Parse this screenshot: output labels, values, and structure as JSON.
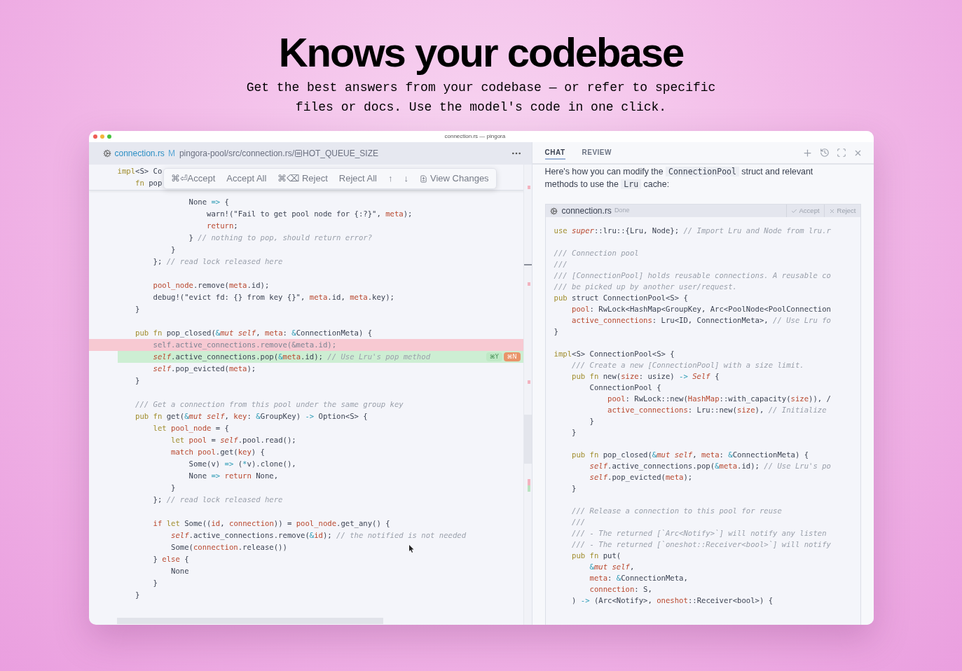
{
  "hero": {
    "title": "Knows your codebase",
    "subtitle": "Get the best answers from your codebase — or refer to specific files or docs. Use the model's code in one click."
  },
  "window": {
    "title": "connection.rs — pingora"
  },
  "editor": {
    "breadcrumb": {
      "file": "connection.rs",
      "status": "M",
      "path": "pingora-pool/src/connection.rs/",
      "symbol": "HOT_QUEUE_SIZE"
    },
    "sticky_lines": [
      {
        "kind": "plain",
        "segs": [
          {
            "text": "impl",
            "kind": "keyword"
          },
          {
            "text": "<S> Co",
            "kind": "plain"
          }
        ]
      },
      {
        "kind": "plain",
        "segs": [
          {
            "text": "    fn",
            "kind": "keyword"
          },
          {
            "text": " pop",
            "kind": "plain"
          }
        ]
      }
    ],
    "diff_toolbar": [
      {
        "label": "⌘⏎Accept",
        "kind": "text"
      },
      {
        "label": "Accept All",
        "kind": "text"
      },
      {
        "label": "⌘⌫ Reject",
        "kind": "text"
      },
      {
        "label": "Reject All",
        "kind": "text"
      },
      {
        "label": "↑",
        "kind": "text"
      },
      {
        "label": "↓",
        "kind": "text"
      },
      {
        "label": "View Changes",
        "kind": "icon"
      }
    ],
    "lines": [
      {
        "kind": "plain",
        "segs": [
          {
            "text": "                None ",
            "kind": "plain"
          },
          {
            "text": "=>",
            "kind": "operator"
          },
          {
            "text": " {",
            "kind": "plain"
          }
        ]
      },
      {
        "kind": "plain",
        "segs": [
          {
            "text": "                    warn!(\"Fail to get pool node for {:?}\", ",
            "kind": "plain"
          },
          {
            "text": "meta",
            "kind": "variable"
          },
          {
            "text": ");",
            "kind": "plain"
          }
        ]
      },
      {
        "kind": "plain",
        "segs": [
          {
            "text": "                    return",
            "kind": "variable"
          },
          {
            "text": ";",
            "kind": "plain"
          }
        ]
      },
      {
        "kind": "plain",
        "segs": [
          {
            "text": "                } ",
            "kind": "plain"
          },
          {
            "text": "// nothing to pop, should return error?",
            "kind": "comment"
          }
        ]
      },
      {
        "kind": "plain",
        "segs": [
          {
            "text": "            }",
            "kind": "plain"
          }
        ]
      },
      {
        "kind": "plain",
        "segs": [
          {
            "text": "        }; ",
            "kind": "plain"
          },
          {
            "text": "// read lock released here",
            "kind": "comment"
          }
        ]
      },
      {
        "kind": "blank"
      },
      {
        "kind": "plain",
        "segs": [
          {
            "text": "        pool_node",
            "kind": "variable"
          },
          {
            "text": ".remove(",
            "kind": "plain"
          },
          {
            "text": "meta",
            "kind": "variable"
          },
          {
            "text": ".id);",
            "kind": "plain"
          }
        ]
      },
      {
        "kind": "plain",
        "segs": [
          {
            "text": "        debug!(\"evict fd: {} from key {}\", ",
            "kind": "plain"
          },
          {
            "text": "meta",
            "kind": "variable"
          },
          {
            "text": ".id, ",
            "kind": "plain"
          },
          {
            "text": "meta",
            "kind": "variable"
          },
          {
            "text": ".key);",
            "kind": "plain"
          }
        ]
      },
      {
        "kind": "plain",
        "segs": [
          {
            "text": "    }",
            "kind": "plain"
          }
        ]
      },
      {
        "kind": "blank"
      },
      {
        "kind": "plain",
        "segs": [
          {
            "text": "    pub fn",
            "kind": "keyword"
          },
          {
            "text": " pop_closed(",
            "kind": "plain"
          },
          {
            "text": "&",
            "kind": "operator"
          },
          {
            "text": "mut self",
            "kind": "self"
          },
          {
            "text": ", ",
            "kind": "plain"
          },
          {
            "text": "meta",
            "kind": "variable"
          },
          {
            "text": ": ",
            "kind": "plain"
          },
          {
            "text": "&",
            "kind": "operator"
          },
          {
            "text": "ConnectionMeta) {",
            "kind": "plain"
          }
        ]
      },
      {
        "kind": "removed",
        "segs": [
          {
            "text": "        self.active_connections.remove(&meta.id);",
            "kind": "plain"
          }
        ]
      },
      {
        "kind": "added",
        "segs": [
          {
            "text": "        self",
            "kind": "self"
          },
          {
            "text": ".active_connections.pop(",
            "kind": "plain"
          },
          {
            "text": "&",
            "kind": "operator"
          },
          {
            "text": "meta",
            "kind": "variable"
          },
          {
            "text": ".id); ",
            "kind": "plain"
          },
          {
            "text": "// Use Lru's pop method",
            "kind": "comment"
          }
        ],
        "shortcuts": [
          "⌘Y",
          "⌘N"
        ]
      },
      {
        "kind": "plain",
        "segs": [
          {
            "text": "        self",
            "kind": "self"
          },
          {
            "text": ".pop_evicted(",
            "kind": "plain"
          },
          {
            "text": "meta",
            "kind": "variable"
          },
          {
            "text": ");",
            "kind": "plain"
          }
        ]
      },
      {
        "kind": "plain",
        "segs": [
          {
            "text": "    }",
            "kind": "plain"
          }
        ]
      },
      {
        "kind": "blank"
      },
      {
        "kind": "plain",
        "segs": [
          {
            "text": "    /// Get a connection from this pool under the same group key",
            "kind": "comment"
          }
        ]
      },
      {
        "kind": "plain",
        "segs": [
          {
            "text": "    pub fn",
            "kind": "keyword"
          },
          {
            "text": " get(",
            "kind": "plain"
          },
          {
            "text": "&",
            "kind": "operator"
          },
          {
            "text": "mut self",
            "kind": "self"
          },
          {
            "text": ", ",
            "kind": "plain"
          },
          {
            "text": "key",
            "kind": "variable"
          },
          {
            "text": ": ",
            "kind": "plain"
          },
          {
            "text": "&",
            "kind": "operator"
          },
          {
            "text": "GroupKey) ",
            "kind": "plain"
          },
          {
            "text": "->",
            "kind": "operator"
          },
          {
            "text": " Option<S> {",
            "kind": "plain"
          }
        ]
      },
      {
        "kind": "plain",
        "segs": [
          {
            "text": "        let ",
            "kind": "keyword"
          },
          {
            "text": "pool_node",
            "kind": "variable"
          },
          {
            "text": " = {",
            "kind": "plain"
          }
        ]
      },
      {
        "kind": "plain",
        "segs": [
          {
            "text": "            let ",
            "kind": "keyword"
          },
          {
            "text": "pool",
            "kind": "variable"
          },
          {
            "text": " = ",
            "kind": "plain"
          },
          {
            "text": "self",
            "kind": "self"
          },
          {
            "text": ".pool.read();",
            "kind": "plain"
          }
        ]
      },
      {
        "kind": "plain",
        "segs": [
          {
            "text": "            match ",
            "kind": "variable"
          },
          {
            "text": "pool",
            "kind": "variable"
          },
          {
            "text": ".get(",
            "kind": "plain"
          },
          {
            "text": "key",
            "kind": "variable"
          },
          {
            "text": ") {",
            "kind": "plain"
          }
        ]
      },
      {
        "kind": "plain",
        "segs": [
          {
            "text": "                Some(v) ",
            "kind": "plain"
          },
          {
            "text": "=>",
            "kind": "operator"
          },
          {
            "text": " (",
            "kind": "plain"
          },
          {
            "text": "*",
            "kind": "operator"
          },
          {
            "text": "v).clone(),",
            "kind": "plain"
          }
        ]
      },
      {
        "kind": "plain",
        "segs": [
          {
            "text": "                None ",
            "kind": "plain"
          },
          {
            "text": "=> ",
            "kind": "operator"
          },
          {
            "text": "return",
            "kind": "variable"
          },
          {
            "text": " None,",
            "kind": "plain"
          }
        ]
      },
      {
        "kind": "plain",
        "segs": [
          {
            "text": "            }",
            "kind": "plain"
          }
        ]
      },
      {
        "kind": "plain",
        "segs": [
          {
            "text": "        }; ",
            "kind": "plain"
          },
          {
            "text": "// read lock released here",
            "kind": "comment"
          }
        ]
      },
      {
        "kind": "blank"
      },
      {
        "kind": "plain",
        "segs": [
          {
            "text": "        if ",
            "kind": "variable"
          },
          {
            "text": "let",
            "kind": "keyword"
          },
          {
            "text": " Some((",
            "kind": "plain"
          },
          {
            "text": "id",
            "kind": "variable"
          },
          {
            "text": ", ",
            "kind": "plain"
          },
          {
            "text": "connection",
            "kind": "variable"
          },
          {
            "text": ")) = ",
            "kind": "plain"
          },
          {
            "text": "pool_node",
            "kind": "variable"
          },
          {
            "text": ".get_any() {",
            "kind": "plain"
          }
        ]
      },
      {
        "kind": "plain",
        "segs": [
          {
            "text": "            self",
            "kind": "self"
          },
          {
            "text": ".active_connections.remove(",
            "kind": "plain"
          },
          {
            "text": "&",
            "kind": "operator"
          },
          {
            "text": "id",
            "kind": "variable"
          },
          {
            "text": "); ",
            "kind": "plain"
          },
          {
            "text": "// the notified is not needed",
            "kind": "comment"
          }
        ]
      },
      {
        "kind": "plain",
        "segs": [
          {
            "text": "            Some(",
            "kind": "plain"
          },
          {
            "text": "connection",
            "kind": "variable"
          },
          {
            "text": ".release())",
            "kind": "plain"
          }
        ]
      },
      {
        "kind": "plain",
        "segs": [
          {
            "text": "        } ",
            "kind": "plain"
          },
          {
            "text": "else",
            "kind": "variable"
          },
          {
            "text": " {",
            "kind": "plain"
          }
        ]
      },
      {
        "kind": "plain",
        "segs": [
          {
            "text": "            None",
            "kind": "plain"
          }
        ]
      },
      {
        "kind": "plain",
        "segs": [
          {
            "text": "        }",
            "kind": "plain"
          }
        ]
      },
      {
        "kind": "plain",
        "segs": [
          {
            "text": "    }",
            "kind": "plain"
          }
        ]
      }
    ]
  },
  "chat": {
    "tabs": [
      {
        "label": "CHAT",
        "selected": true
      },
      {
        "label": "REVIEW",
        "selected": false
      }
    ],
    "message": [
      {
        "text": "Here's how you can modify the ",
        "kind": "text"
      },
      {
        "text": "ConnectionPool",
        "kind": "code"
      },
      {
        "text": " struct and relevant methods to use the ",
        "kind": "text"
      },
      {
        "text": "Lru",
        "kind": "code"
      },
      {
        "text": " cache:",
        "kind": "text"
      }
    ],
    "code_block": {
      "file": "connection.rs",
      "status": "Done",
      "actions": [
        {
          "label": "Accept",
          "kind": "accept"
        },
        {
          "label": "Reject",
          "kind": "reject"
        }
      ],
      "lines": [
        {
          "kind": "plain",
          "segs": [
            {
              "text": "use ",
              "kind": "keyword"
            },
            {
              "text": "super",
              "kind": "self"
            },
            {
              "text": "::lru::{Lru, Node}; ",
              "kind": "plain"
            },
            {
              "text": "// Import Lru and Node from lru.r",
              "kind": "comment"
            }
          ]
        },
        {
          "kind": "blank"
        },
        {
          "kind": "plain",
          "segs": [
            {
              "text": "/// Connection pool",
              "kind": "comment"
            }
          ]
        },
        {
          "kind": "plain",
          "segs": [
            {
              "text": "///",
              "kind": "comment"
            }
          ]
        },
        {
          "kind": "plain",
          "segs": [
            {
              "text": "/// [ConnectionPool] holds reusable connections. A reusable co",
              "kind": "comment"
            }
          ]
        },
        {
          "kind": "plain",
          "segs": [
            {
              "text": "/// be picked up by another user/request.",
              "kind": "comment"
            }
          ]
        },
        {
          "kind": "plain",
          "segs": [
            {
              "text": "pub",
              "kind": "keyword"
            },
            {
              "text": " struct ConnectionPool<S> {",
              "kind": "plain"
            }
          ]
        },
        {
          "kind": "plain",
          "segs": [
            {
              "text": "    pool",
              "kind": "variable"
            },
            {
              "text": ": RwLock<HashMap<GroupKey, Arc<PoolNode<PoolConnection",
              "kind": "plain"
            }
          ]
        },
        {
          "kind": "plain",
          "segs": [
            {
              "text": "    active_connections",
              "kind": "variable"
            },
            {
              "text": ": Lru<ID, ConnectionMeta>, ",
              "kind": "plain"
            },
            {
              "text": "// Use Lru fo",
              "kind": "comment"
            }
          ]
        },
        {
          "kind": "plain",
          "segs": [
            {
              "text": "}",
              "kind": "plain"
            }
          ]
        },
        {
          "kind": "blank"
        },
        {
          "kind": "plain",
          "segs": [
            {
              "text": "impl",
              "kind": "keyword"
            },
            {
              "text": "<S> ConnectionPool<S> {",
              "kind": "plain"
            }
          ]
        },
        {
          "kind": "plain",
          "segs": [
            {
              "text": "    /// Create a new [ConnectionPool] with a size limit.",
              "kind": "comment"
            }
          ]
        },
        {
          "kind": "plain",
          "segs": [
            {
              "text": "    pub fn",
              "kind": "keyword"
            },
            {
              "text": " new(",
              "kind": "plain"
            },
            {
              "text": "size",
              "kind": "variable"
            },
            {
              "text": ": usize) ",
              "kind": "plain"
            },
            {
              "text": "-> ",
              "kind": "operator"
            },
            {
              "text": "Self",
              "kind": "self"
            },
            {
              "text": " {",
              "kind": "plain"
            }
          ]
        },
        {
          "kind": "plain",
          "segs": [
            {
              "text": "        ConnectionPool {",
              "kind": "plain"
            }
          ]
        },
        {
          "kind": "plain",
          "segs": [
            {
              "text": "            pool",
              "kind": "variable"
            },
            {
              "text": ": RwLock::new(",
              "kind": "plain"
            },
            {
              "text": "HashMap",
              "kind": "variable"
            },
            {
              "text": "::with_capacity(",
              "kind": "plain"
            },
            {
              "text": "size",
              "kind": "variable"
            },
            {
              "text": ")), /",
              "kind": "plain"
            }
          ]
        },
        {
          "kind": "plain",
          "segs": [
            {
              "text": "            active_connections",
              "kind": "variable"
            },
            {
              "text": ": Lru::new(",
              "kind": "plain"
            },
            {
              "text": "size",
              "kind": "variable"
            },
            {
              "text": "), ",
              "kind": "plain"
            },
            {
              "text": "// Initialize",
              "kind": "comment"
            }
          ]
        },
        {
          "kind": "plain",
          "segs": [
            {
              "text": "        }",
              "kind": "plain"
            }
          ]
        },
        {
          "kind": "plain",
          "segs": [
            {
              "text": "    }",
              "kind": "plain"
            }
          ]
        },
        {
          "kind": "blank"
        },
        {
          "kind": "plain",
          "segs": [
            {
              "text": "    pub fn",
              "kind": "keyword"
            },
            {
              "text": " pop_closed(",
              "kind": "plain"
            },
            {
              "text": "&",
              "kind": "operator"
            },
            {
              "text": "mut self",
              "kind": "self"
            },
            {
              "text": ", ",
              "kind": "plain"
            },
            {
              "text": "meta",
              "kind": "variable"
            },
            {
              "text": ": ",
              "kind": "plain"
            },
            {
              "text": "&",
              "kind": "operator"
            },
            {
              "text": "ConnectionMeta) {",
              "kind": "plain"
            }
          ]
        },
        {
          "kind": "plain",
          "segs": [
            {
              "text": "        self",
              "kind": "self"
            },
            {
              "text": ".active_connections.pop(",
              "kind": "plain"
            },
            {
              "text": "&",
              "kind": "operator"
            },
            {
              "text": "meta",
              "kind": "variable"
            },
            {
              "text": ".id); ",
              "kind": "plain"
            },
            {
              "text": "// Use Lru's po",
              "kind": "comment"
            }
          ]
        },
        {
          "kind": "plain",
          "segs": [
            {
              "text": "        self",
              "kind": "self"
            },
            {
              "text": ".pop_evicted(",
              "kind": "plain"
            },
            {
              "text": "meta",
              "kind": "variable"
            },
            {
              "text": ");",
              "kind": "plain"
            }
          ]
        },
        {
          "kind": "plain",
          "segs": [
            {
              "text": "    }",
              "kind": "plain"
            }
          ]
        },
        {
          "kind": "blank"
        },
        {
          "kind": "plain",
          "segs": [
            {
              "text": "    /// Release a connection to this pool for reuse",
              "kind": "comment"
            }
          ]
        },
        {
          "kind": "plain",
          "segs": [
            {
              "text": "    ///",
              "kind": "comment"
            }
          ]
        },
        {
          "kind": "plain",
          "segs": [
            {
              "text": "    /// - The returned [`Arc<Notify>`] will notify any listen",
              "kind": "comment"
            }
          ]
        },
        {
          "kind": "plain",
          "segs": [
            {
              "text": "    /// - The returned [`oneshot::Receiver<bool>`] will notify",
              "kind": "comment"
            }
          ]
        },
        {
          "kind": "plain",
          "segs": [
            {
              "text": "    pub fn",
              "kind": "keyword"
            },
            {
              "text": " put(",
              "kind": "plain"
            }
          ]
        },
        {
          "kind": "plain",
          "segs": [
            {
              "text": "        &",
              "kind": "operator"
            },
            {
              "text": "mut self",
              "kind": "self"
            },
            {
              "text": ",",
              "kind": "plain"
            }
          ]
        },
        {
          "kind": "plain",
          "segs": [
            {
              "text": "        meta",
              "kind": "variable"
            },
            {
              "text": ": ",
              "kind": "plain"
            },
            {
              "text": "&",
              "kind": "operator"
            },
            {
              "text": "ConnectionMeta,",
              "kind": "plain"
            }
          ]
        },
        {
          "kind": "plain",
          "segs": [
            {
              "text": "        connection",
              "kind": "variable"
            },
            {
              "text": ": S,",
              "kind": "plain"
            }
          ]
        },
        {
          "kind": "plain",
          "segs": [
            {
              "text": "    ) ",
              "kind": "plain"
            },
            {
              "text": "->",
              "kind": "operator"
            },
            {
              "text": " (Arc<Notify>, ",
              "kind": "plain"
            },
            {
              "text": "oneshot",
              "kind": "variable"
            },
            {
              "text": "::Receiver<bool>) {",
              "kind": "plain"
            }
          ]
        }
      ]
    }
  }
}
